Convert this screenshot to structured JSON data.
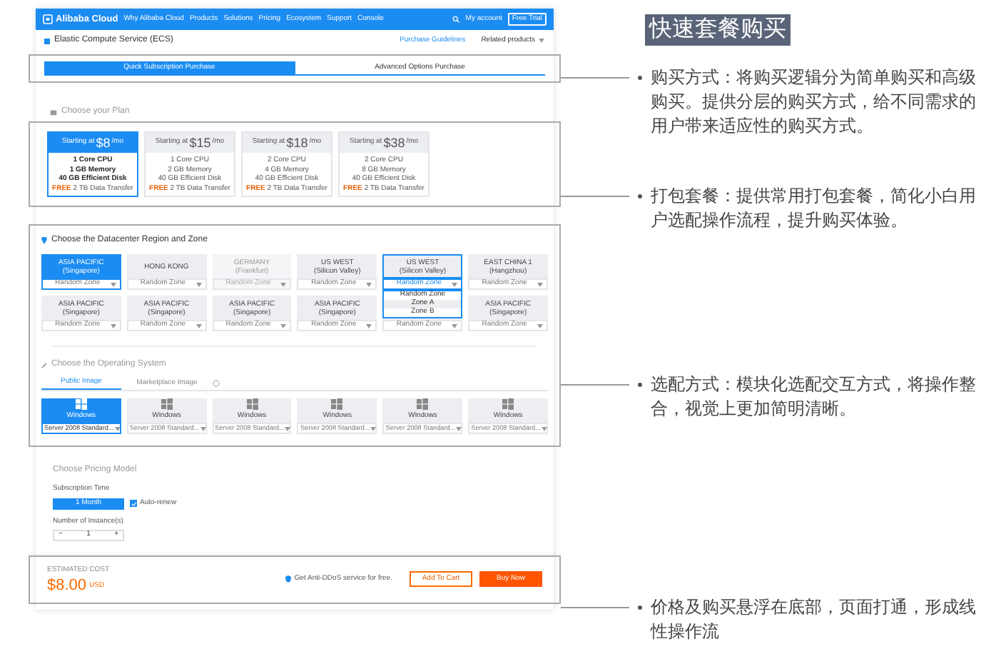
{
  "header": {
    "logo": "Alibaba Cloud",
    "nav": [
      "Why Alibaba Cloud",
      "Products",
      "Solutions",
      "Pricing",
      "Ecosystem",
      "Support",
      "Console"
    ],
    "account": "My account",
    "cta": "Free Trial"
  },
  "product": {
    "title": "Elastic Compute Service (ECS)",
    "guide_link": "Purchase Guidelines",
    "related": "Related products"
  },
  "purchase_tabs": [
    {
      "label": "Quick Subscription Purchase",
      "selected": true
    },
    {
      "label": "Advanced Options Purchase",
      "selected": false
    }
  ],
  "plan_section": {
    "title": "Choose your Plan",
    "plans": [
      {
        "prefix": "Starting at",
        "price": "$8",
        "unit": "/mo",
        "selected": true,
        "specs": [
          "1 Core CPU",
          "1 GB Memory",
          "40 GB Efficient Disk"
        ],
        "badge": "FREE",
        "transfer": "2 TB Data Transfer"
      },
      {
        "prefix": "Starting at",
        "price": "$15",
        "unit": "/mo",
        "selected": false,
        "specs": [
          "1 Core CPU",
          "2 GB Memory",
          "40 GB Efficient Disk"
        ],
        "badge": "FREE",
        "transfer": "2 TB Data Transfer"
      },
      {
        "prefix": "Starting at",
        "price": "$18",
        "unit": "/mo",
        "selected": false,
        "specs": [
          "2 Core CPU",
          "4 GB Memory",
          "40 GB Efficient Disk"
        ],
        "badge": "FREE",
        "transfer": "2 TB Data Transfer"
      },
      {
        "prefix": "Starting at",
        "price": "$38",
        "unit": "/mo",
        "selected": false,
        "specs": [
          "2 Core CPU",
          "8 GB Memory",
          "40 GB Efficient Disk"
        ],
        "badge": "FREE",
        "transfer": "2 TB Data Transfer"
      }
    ]
  },
  "region_section": {
    "title": "Choose the Datacenter Region and Zone",
    "regions": [
      {
        "name": "ASIA PACIFIC",
        "city": "(Singapore)",
        "zone": "Random Zone",
        "selected": true,
        "disabled": false,
        "expanded": false
      },
      {
        "name": "HONG KONG",
        "zone": "Random Zone",
        "selected": false,
        "disabled": false,
        "expanded": false
      },
      {
        "name": "GERMANY",
        "city": "(Frankfurt)",
        "zone": "Random Zone",
        "selected": false,
        "disabled": true,
        "expanded": false
      },
      {
        "name": "US WEST",
        "city": "(Silicon Valley)",
        "zone": "Random Zone",
        "selected": false,
        "disabled": false,
        "expanded": false
      },
      {
        "name": "US WEST",
        "city": "(Silicon Valley)",
        "zone": "Random Zone",
        "selected": false,
        "disabled": false,
        "expanded": true
      },
      {
        "name": "EAST CHINA 1",
        "city": "(Hangzhou)",
        "zone": "Random Zone",
        "selected": false,
        "disabled": false,
        "expanded": false
      },
      {
        "name": "ASIA PACIFIC",
        "city": "(Singapore)",
        "zone": "Random Zone",
        "selected": false,
        "disabled": false,
        "expanded": false
      },
      {
        "name": "ASIA PACIFIC",
        "city": "(Singapore)",
        "zone": "Random Zone",
        "selected": false,
        "disabled": false,
        "expanded": false
      },
      {
        "name": "ASIA PACIFIC",
        "city": "(Singapore)",
        "zone": "Random Zone",
        "selected": false,
        "disabled": false,
        "expanded": false
      },
      {
        "name": "ASIA PACIFIC",
        "city": "(Singapore)",
        "zone": "Random Zone",
        "selected": false,
        "disabled": false,
        "expanded": false
      },
      {
        "zone": "Random Zone",
        "selected": false,
        "disabled": false,
        "expanded": false
      },
      {
        "name": "ASIA PACIFIC",
        "city": "(Singapore)",
        "zone": "Random Zone",
        "selected": false,
        "disabled": false,
        "expanded": false
      }
    ],
    "zone_options": [
      {
        "label": "Random Zone",
        "selected": false
      },
      {
        "label": "Zone A",
        "selected": true
      },
      {
        "label": "Zone B",
        "selected": false
      }
    ]
  },
  "os_section": {
    "title": "Choose the Operating System",
    "tabs": [
      {
        "label": "Public Image",
        "selected": true
      },
      {
        "label": "Marketplace Image",
        "selected": false
      }
    ],
    "images": [
      {
        "name": "Windows",
        "version": "Server 2008 Standard...",
        "selected": true
      },
      {
        "name": "Windows",
        "version": "Server 2008 Standard...",
        "selected": false
      },
      {
        "name": "Windows",
        "version": "Server 2008 Standard...",
        "selected": false
      },
      {
        "name": "Windows",
        "version": "Server 2008 Standard...",
        "selected": false
      },
      {
        "name": "Windows",
        "version": "Server 2008 Standard...",
        "selected": false
      },
      {
        "name": "Windows",
        "version": "Server 2008 Standard...",
        "selected": false
      }
    ]
  },
  "pricing": {
    "title": "Choose Pricing Model",
    "time_label": "Subscription Time",
    "time": "1 Month",
    "auto_renew": {
      "label": "Auto-renew",
      "checked": true
    },
    "count_label": "Number of Instance(s)",
    "minus": "−",
    "count": "1",
    "plus": "+"
  },
  "footer": {
    "cost_label": "ESTIMATED COST",
    "cost": "$8.00",
    "currency": "USD",
    "ddos": "Get Anti-DDoS service for free.",
    "cart": "Add To Cart",
    "buy": "Buy Now"
  },
  "annotations": {
    "title": "快速套餐购买",
    "bullets": [
      "购买方式：将购买逻辑分为简单购买和高级购买。提供分层的购买方式，给不同需求的用户带来适应性的购买方式。",
      "打包套餐：提供常用打包套餐，简化小白用户选配操作流程，提升购买体验。",
      "选配方式：模块化选配交互方式，将操作整合，视觉上更加简明清晰。",
      "价格及购买悬浮在底部，页面打通，形成线性操作流"
    ]
  }
}
